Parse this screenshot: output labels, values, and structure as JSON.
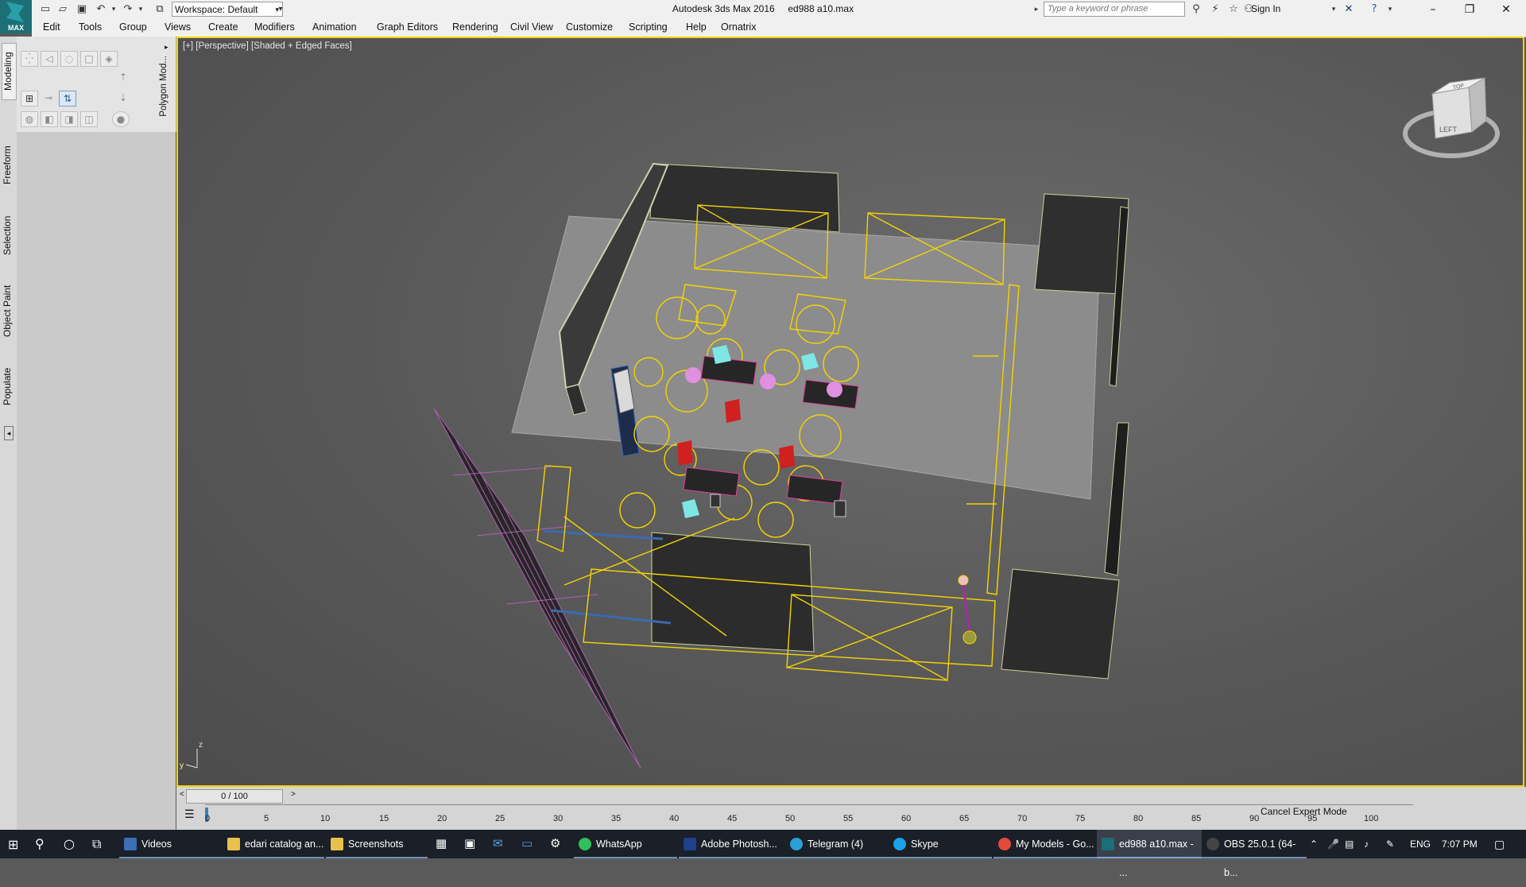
{
  "app": {
    "title": "Autodesk 3ds Max 2016     ed988 a10.max",
    "logo_text": "MAX",
    "workspace": "Workspace: Default",
    "search_placeholder": "Type a keyword or phrase",
    "sign_in": "Sign In"
  },
  "menu": [
    "Edit",
    "Tools",
    "Group",
    "Views",
    "Create",
    "Modifiers",
    "Animation",
    "Graph Editors",
    "Rendering",
    "Civil View",
    "Customize",
    "Scripting",
    "Help",
    "Ornatrix"
  ],
  "left_tabs": [
    "Modeling",
    "Freeform",
    "Selection",
    "Object Paint",
    "Populate"
  ],
  "ribbon": {
    "panel_label": "Polygon Mod..."
  },
  "viewport": {
    "label": "[+] [Perspective] [Shaded + Edged Faces]",
    "viewcube_face": "LEFT",
    "viewcube_top": "TOP"
  },
  "timeline": {
    "slider": "0 / 100",
    "ticks": [
      "0",
      "5",
      "10",
      "15",
      "20",
      "25",
      "30",
      "35",
      "40",
      "45",
      "50",
      "55",
      "60",
      "65",
      "70",
      "75",
      "80",
      "85",
      "90",
      "95",
      "100"
    ],
    "cancel_expert": "Cancel Expert Mode"
  },
  "taskbar": {
    "items": [
      {
        "label": "Videos",
        "color": "#3b6fb6"
      },
      {
        "label": "edari catalog an...",
        "color": "#e8c14a"
      },
      {
        "label": "Screenshots",
        "color": "#e8c14a"
      },
      {
        "label": "WhatsApp",
        "color": "#2fbf5b"
      },
      {
        "label": "Adobe Photosh...",
        "color": "#1f3f8f"
      },
      {
        "label": "Telegram (4)",
        "color": "#2a9fd8"
      },
      {
        "label": "Skype",
        "color": "#1aa3e8"
      },
      {
        "label": "My Models - Go...",
        "color": "#e34a3b"
      },
      {
        "label": "ed988 a10.max - ...",
        "color": "#1c6f76"
      },
      {
        "label": "OBS 25.0.1 (64-b...",
        "color": "#444444"
      }
    ],
    "lang": "ENG",
    "time": "7:07 PM"
  },
  "colors": {
    "selection_yellow": "#f5d400",
    "wall_dark": "#2f2f2f",
    "floor": "#8a8a8a",
    "chair_cyan": "#7fe6e6",
    "chair_red": "#d02020",
    "pink": "#e090e0"
  }
}
